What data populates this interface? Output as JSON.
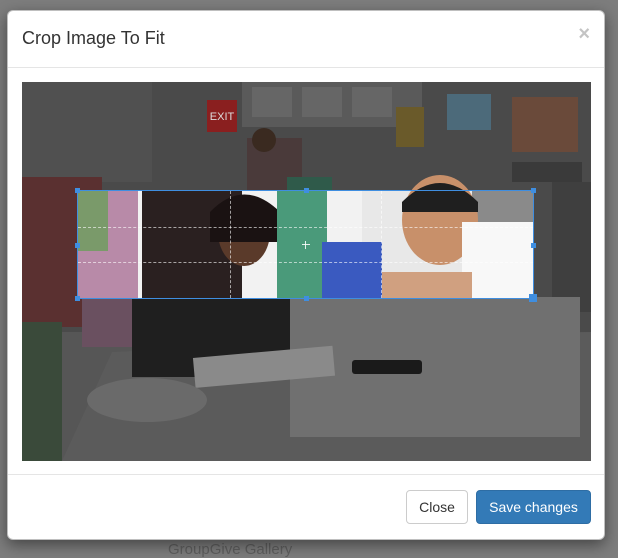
{
  "background": {
    "partial_text": "GroupGive Gallery"
  },
  "modal": {
    "title": "Crop Image To Fit",
    "close_symbol": "×"
  },
  "image": {
    "exit_sign": "EXIT"
  },
  "footer": {
    "close_label": "Close",
    "save_label": "Save changes"
  },
  "colors": {
    "primary": "#337ab7",
    "crop_outline": "#3f8ee0"
  }
}
